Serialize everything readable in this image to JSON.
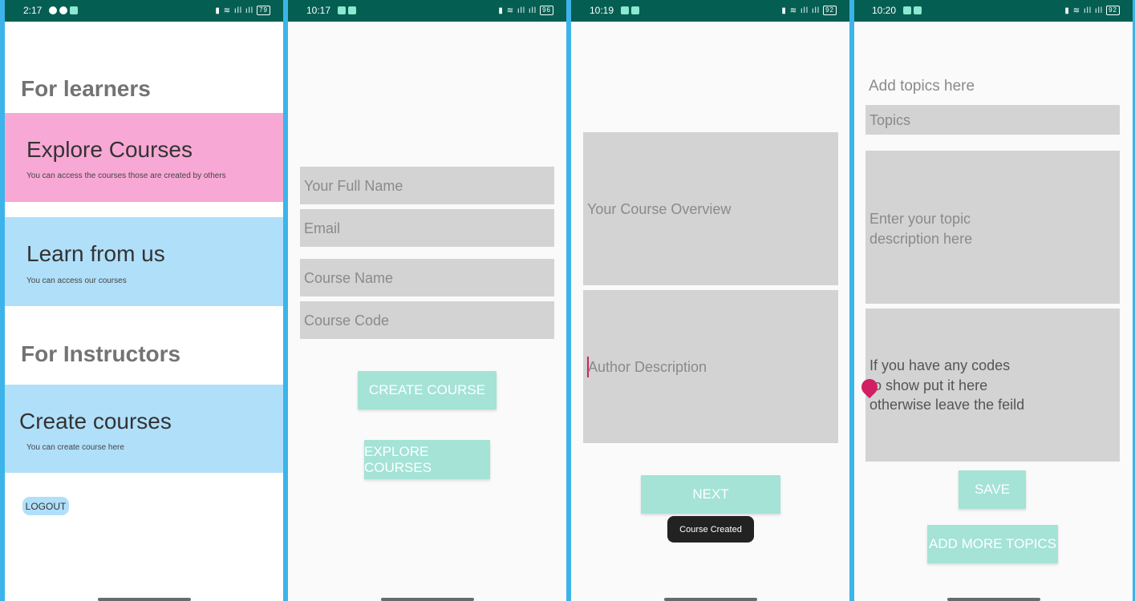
{
  "screen1": {
    "status_time": "2:17",
    "battery": "79",
    "learners_heading": "For learners",
    "explore_card": {
      "title": "Explore Courses",
      "subtitle": "You can access the courses those are created by others"
    },
    "learn_card": {
      "title": "Learn from us",
      "subtitle": "You can access our courses"
    },
    "instructors_heading": "For Instructors",
    "create_card": {
      "title": "Create courses",
      "subtitle": "You can create course here"
    },
    "logout_label": "LOGOUT"
  },
  "screen2": {
    "status_time": "10:17",
    "battery": "96",
    "full_name_placeholder": "Your Full Name",
    "email_placeholder": "Email",
    "course_name_placeholder": "Course Name",
    "course_code_placeholder": "Course Code",
    "create_button": "CREATE COURSE",
    "explore_button": "EXPLORE COURSES"
  },
  "screen3": {
    "status_time": "10:19",
    "battery": "92",
    "overview_placeholder": "Your Course Overview",
    "author_placeholder": "Author Description",
    "next_button": "NEXT",
    "toast": "Course Created"
  },
  "screen4": {
    "status_time": "10:20",
    "battery": "92",
    "add_topics_label": "Add topics here",
    "topics_placeholder": "Topics",
    "topic_description_placeholder": "Enter your topic description here",
    "codes_line1": "If you have any codes",
    "codes_line2": "to show put it here",
    "codes_line3": "otherwise leave the feild",
    "save_button": "SAVE",
    "add_more_button": "ADD MORE TOPICS"
  },
  "colors": {
    "status_bar": "#055e52",
    "pink_card": "#f8a8d4",
    "blue_card": "#b0dffa",
    "field": "#d3d3d3",
    "button": "#a4e3d6",
    "frame": "#3cb4ea",
    "cursor_handle": "#d21e62"
  }
}
